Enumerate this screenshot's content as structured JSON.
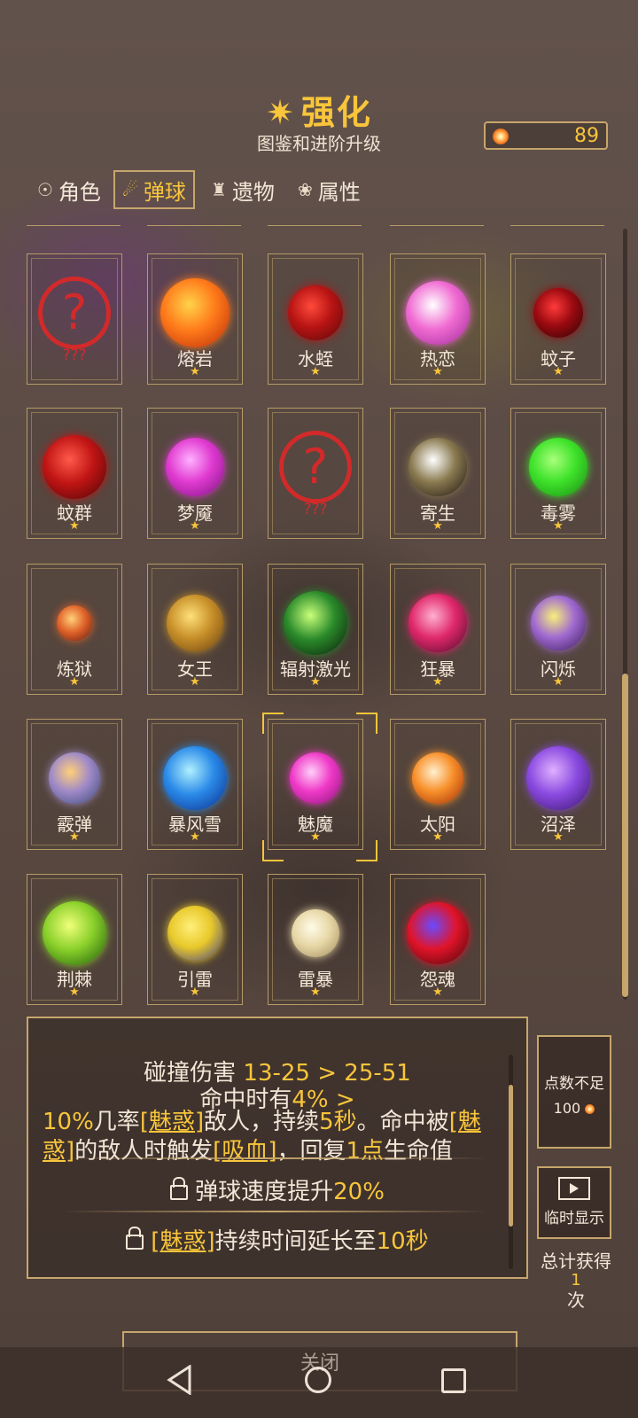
{
  "header": {
    "title": "强化",
    "subtitle": "图鉴和进阶升级",
    "currency_value": "89"
  },
  "tabs": [
    {
      "label": "角色",
      "icon": "character-icon",
      "active": false
    },
    {
      "label": "弹球",
      "icon": "ball-icon",
      "active": true
    },
    {
      "label": "遗物",
      "icon": "trophy-icon",
      "active": false
    },
    {
      "label": "属性",
      "icon": "flower-icon",
      "active": false
    }
  ],
  "balls": [
    {
      "name": "???",
      "unknown": true,
      "star": false
    },
    {
      "name": "熔岩",
      "colors": [
        "#ffd34a",
        "#ff7a1a",
        "#b82a08"
      ],
      "star": true
    },
    {
      "name": "水蛭",
      "colors": [
        "#ff4a3a",
        "#b81414",
        "#5a0808"
      ],
      "star": true
    },
    {
      "name": "热恋",
      "colors": [
        "#ffffff",
        "#f06bd2",
        "#a02a98"
      ],
      "star": true
    },
    {
      "name": "蚊子",
      "colors": [
        "#ff3a3a",
        "#9a0a10",
        "#2a0406"
      ],
      "star": true
    },
    {
      "name": "蚊群",
      "colors": [
        "#ff5a4a",
        "#c01414",
        "#4a0606"
      ],
      "star": true
    },
    {
      "name": "梦魇",
      "colors": [
        "#ffb0ff",
        "#e03ad0",
        "#7a1480"
      ],
      "star": true
    },
    {
      "name": "???",
      "unknown": true,
      "star": false
    },
    {
      "name": "寄生",
      "colors": [
        "#ffffff",
        "#8a7a50",
        "#1a1410"
      ],
      "star": true
    },
    {
      "name": "毒雾",
      "colors": [
        "#a8ff7a",
        "#3ee22a",
        "#1a8a14"
      ],
      "star": true
    },
    {
      "name": "炼狱",
      "colors": [
        "#ffd07a",
        "#e0642a",
        "#6a1a10"
      ],
      "star": true
    },
    {
      "name": "女王",
      "colors": [
        "#ffe07a",
        "#c8902a",
        "#6a4010"
      ],
      "star": true
    },
    {
      "name": "辐射激光",
      "colors": [
        "#c8ff7a",
        "#2a8a2a",
        "#0a1a0a"
      ],
      "star": true
    },
    {
      "name": "狂暴",
      "colors": [
        "#ffb0d0",
        "#e0286a",
        "#4a0a2a"
      ],
      "star": true
    },
    {
      "name": "闪烁",
      "colors": [
        "#f8f07a",
        "#a06ad0",
        "#3a1a5a"
      ],
      "star": true
    },
    {
      "name": "霰弹",
      "colors": [
        "#ffd07a",
        "#a08ac8",
        "#3a4a7a"
      ],
      "star": true
    },
    {
      "name": "暴风雪",
      "colors": [
        "#b0f0ff",
        "#2a8ae8",
        "#0a2a8a"
      ],
      "star": true
    },
    {
      "name": "魅魔",
      "colors": [
        "#ffd0f8",
        "#f03ac8",
        "#8a1478"
      ],
      "star": true
    },
    {
      "name": "太阳",
      "colors": [
        "#fff0d0",
        "#f8902a",
        "#a02a08"
      ],
      "star": true
    },
    {
      "name": "沼泽",
      "colors": [
        "#e0b0ff",
        "#8a4ae0",
        "#3a146a"
      ],
      "star": true
    },
    {
      "name": "荆棘",
      "colors": [
        "#f0ff7a",
        "#8ad02a",
        "#1a5a0a"
      ],
      "star": true
    },
    {
      "name": "引雷",
      "colors": [
        "#fff07a",
        "#e8c82a",
        "#3a3a8a"
      ],
      "star": true
    },
    {
      "name": "雷暴",
      "colors": [
        "#fffbe8",
        "#e8d8a8",
        "#a08a5a"
      ],
      "star": true
    },
    {
      "name": "怨魂",
      "colors": [
        "#6a4aff",
        "#e0142a",
        "#4a0608"
      ],
      "star": true
    }
  ],
  "star_glyph": "★",
  "info": {
    "label1": "碰撞伤害",
    "val1": "13-25 > 25-51",
    "label2": "命中时有",
    "val2": "4% >",
    "l3a": "10%",
    "l3b": "几率",
    "l3c": "[魅惑]",
    "l3d": "敌人，持续",
    "l3e": "5秒",
    "l3f": "。命中被",
    "l3g": "[魅惑]",
    "l3h": "的敌人时触发",
    "l3i": "[吸血]",
    "l3j": "，回复",
    "l3k": "1点",
    "l3l": "生命值",
    "upg1_label": "弹球速度提升",
    "upg1_val": "20%",
    "upg2_tag": "[魅惑]",
    "upg2_label": "持续时间延长至",
    "upg2_val": "10秒"
  },
  "side": {
    "insufficient": "点数不足",
    "cost": "100",
    "temp_show": "临时显示",
    "total_label": "总计获得",
    "total_count": "1",
    "total_unit": "次"
  },
  "close_label": "关闭",
  "colors": {
    "accent": "#f8c53b",
    "border": "#c7a66c",
    "unknown": "#d22a2a"
  }
}
